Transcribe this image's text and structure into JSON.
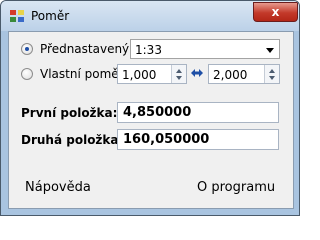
{
  "window": {
    "title": "Poměr",
    "close_label": "x"
  },
  "ratio_preset": {
    "label": "Přednastavený poměr",
    "value": "1:33",
    "checked": true
  },
  "ratio_custom": {
    "label": "Vlastní poměr",
    "left_value": "1,000",
    "right_value": "2,000",
    "checked": false
  },
  "item_first": {
    "label": "První položka:",
    "value": "4,850000"
  },
  "item_second": {
    "label": "Druhá položka:",
    "value": "160,050000"
  },
  "footer": {
    "help_label": "Nápověda",
    "about_label": "O programu"
  }
}
